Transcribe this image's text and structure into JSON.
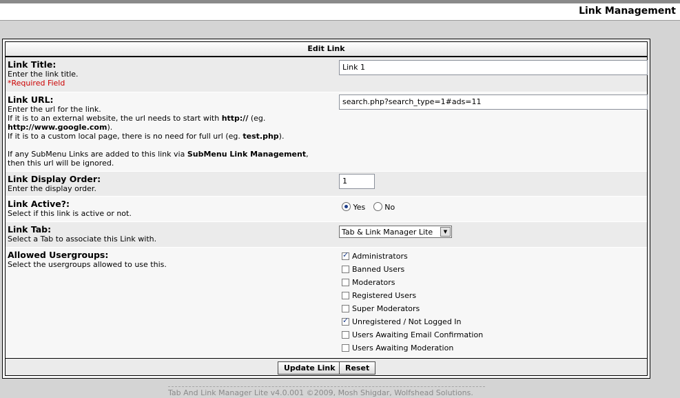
{
  "header": {
    "title": "Link Management"
  },
  "panel": {
    "heading": "Edit Link",
    "link_title": {
      "label": "Link Title:",
      "desc": "Enter the link title.",
      "required": "*Required Field",
      "value": "Link 1"
    },
    "link_url": {
      "label": "Link URL:",
      "desc1": "Enter the url for the link.",
      "desc2_pre": "If it is to an external website, the url needs to start with ",
      "desc2_bold": "http://",
      "desc2_post": " (eg.",
      "desc3_bold": "http://www.google.com",
      "desc3_post": ").",
      "desc4_pre": "If it is to a custom local page, there is no need for full url (eg. ",
      "desc4_bold": "test.php",
      "desc4_post": ").",
      "desc5_pre": "If any SubMenu Links are added to this link via ",
      "desc5_bold": "SubMenu Link Management",
      "desc5_post": ",",
      "desc6": "then this url will be ignored.",
      "value": "search.php?search_type=1#ads=11"
    },
    "display_order": {
      "label": "Link Display Order:",
      "desc": "Enter the display order.",
      "value": "1"
    },
    "active": {
      "label": "Link Active?:",
      "desc": "Select if this link is active or not.",
      "yes_label": "Yes",
      "no_label": "No",
      "selected": "Yes"
    },
    "tab": {
      "label": "Link Tab:",
      "desc": "Select a Tab to associate this Link with.",
      "selected": "Tab & Link Manager Lite"
    },
    "usergroups": {
      "label": "Allowed Usergroups:",
      "desc": "Select the usergroups allowed to use this.",
      "items": [
        {
          "label": "Administrators",
          "checked": true
        },
        {
          "label": "Banned Users",
          "checked": false
        },
        {
          "label": "Moderators",
          "checked": false
        },
        {
          "label": "Registered Users",
          "checked": false
        },
        {
          "label": "Super Moderators",
          "checked": false
        },
        {
          "label": "Unregistered / Not Logged In",
          "checked": true
        },
        {
          "label": "Users Awaiting Email Confirmation",
          "checked": false
        },
        {
          "label": "Users Awaiting Moderation",
          "checked": false
        }
      ]
    },
    "buttons": {
      "update": "Update Link",
      "reset": "Reset"
    }
  },
  "footer": {
    "copyright": "Tab And Link Manager Lite v4.0.001 ©2009, Mosh Shigdar, Wolfshead Solutions."
  }
}
